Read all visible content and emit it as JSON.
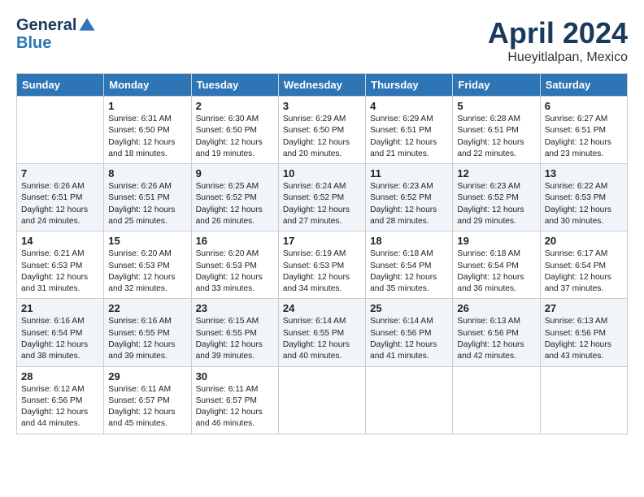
{
  "header": {
    "logo_line1": "General",
    "logo_line2": "Blue",
    "month_title": "April 2024",
    "location": "Hueyitlalpan, Mexico"
  },
  "days_of_week": [
    "Sunday",
    "Monday",
    "Tuesday",
    "Wednesday",
    "Thursday",
    "Friday",
    "Saturday"
  ],
  "weeks": [
    [
      {
        "day": "",
        "sunrise": "",
        "sunset": "",
        "daylight": ""
      },
      {
        "day": "1",
        "sunrise": "Sunrise: 6:31 AM",
        "sunset": "Sunset: 6:50 PM",
        "daylight": "Daylight: 12 hours and 18 minutes."
      },
      {
        "day": "2",
        "sunrise": "Sunrise: 6:30 AM",
        "sunset": "Sunset: 6:50 PM",
        "daylight": "Daylight: 12 hours and 19 minutes."
      },
      {
        "day": "3",
        "sunrise": "Sunrise: 6:29 AM",
        "sunset": "Sunset: 6:50 PM",
        "daylight": "Daylight: 12 hours and 20 minutes."
      },
      {
        "day": "4",
        "sunrise": "Sunrise: 6:29 AM",
        "sunset": "Sunset: 6:51 PM",
        "daylight": "Daylight: 12 hours and 21 minutes."
      },
      {
        "day": "5",
        "sunrise": "Sunrise: 6:28 AM",
        "sunset": "Sunset: 6:51 PM",
        "daylight": "Daylight: 12 hours and 22 minutes."
      },
      {
        "day": "6",
        "sunrise": "Sunrise: 6:27 AM",
        "sunset": "Sunset: 6:51 PM",
        "daylight": "Daylight: 12 hours and 23 minutes."
      }
    ],
    [
      {
        "day": "7",
        "sunrise": "Sunrise: 6:26 AM",
        "sunset": "Sunset: 6:51 PM",
        "daylight": "Daylight: 12 hours and 24 minutes."
      },
      {
        "day": "8",
        "sunrise": "Sunrise: 6:26 AM",
        "sunset": "Sunset: 6:51 PM",
        "daylight": "Daylight: 12 hours and 25 minutes."
      },
      {
        "day": "9",
        "sunrise": "Sunrise: 6:25 AM",
        "sunset": "Sunset: 6:52 PM",
        "daylight": "Daylight: 12 hours and 26 minutes."
      },
      {
        "day": "10",
        "sunrise": "Sunrise: 6:24 AM",
        "sunset": "Sunset: 6:52 PM",
        "daylight": "Daylight: 12 hours and 27 minutes."
      },
      {
        "day": "11",
        "sunrise": "Sunrise: 6:23 AM",
        "sunset": "Sunset: 6:52 PM",
        "daylight": "Daylight: 12 hours and 28 minutes."
      },
      {
        "day": "12",
        "sunrise": "Sunrise: 6:23 AM",
        "sunset": "Sunset: 6:52 PM",
        "daylight": "Daylight: 12 hours and 29 minutes."
      },
      {
        "day": "13",
        "sunrise": "Sunrise: 6:22 AM",
        "sunset": "Sunset: 6:53 PM",
        "daylight": "Daylight: 12 hours and 30 minutes."
      }
    ],
    [
      {
        "day": "14",
        "sunrise": "Sunrise: 6:21 AM",
        "sunset": "Sunset: 6:53 PM",
        "daylight": "Daylight: 12 hours and 31 minutes."
      },
      {
        "day": "15",
        "sunrise": "Sunrise: 6:20 AM",
        "sunset": "Sunset: 6:53 PM",
        "daylight": "Daylight: 12 hours and 32 minutes."
      },
      {
        "day": "16",
        "sunrise": "Sunrise: 6:20 AM",
        "sunset": "Sunset: 6:53 PM",
        "daylight": "Daylight: 12 hours and 33 minutes."
      },
      {
        "day": "17",
        "sunrise": "Sunrise: 6:19 AM",
        "sunset": "Sunset: 6:53 PM",
        "daylight": "Daylight: 12 hours and 34 minutes."
      },
      {
        "day": "18",
        "sunrise": "Sunrise: 6:18 AM",
        "sunset": "Sunset: 6:54 PM",
        "daylight": "Daylight: 12 hours and 35 minutes."
      },
      {
        "day": "19",
        "sunrise": "Sunrise: 6:18 AM",
        "sunset": "Sunset: 6:54 PM",
        "daylight": "Daylight: 12 hours and 36 minutes."
      },
      {
        "day": "20",
        "sunrise": "Sunrise: 6:17 AM",
        "sunset": "Sunset: 6:54 PM",
        "daylight": "Daylight: 12 hours and 37 minutes."
      }
    ],
    [
      {
        "day": "21",
        "sunrise": "Sunrise: 6:16 AM",
        "sunset": "Sunset: 6:54 PM",
        "daylight": "Daylight: 12 hours and 38 minutes."
      },
      {
        "day": "22",
        "sunrise": "Sunrise: 6:16 AM",
        "sunset": "Sunset: 6:55 PM",
        "daylight": "Daylight: 12 hours and 39 minutes."
      },
      {
        "day": "23",
        "sunrise": "Sunrise: 6:15 AM",
        "sunset": "Sunset: 6:55 PM",
        "daylight": "Daylight: 12 hours and 39 minutes."
      },
      {
        "day": "24",
        "sunrise": "Sunrise: 6:14 AM",
        "sunset": "Sunset: 6:55 PM",
        "daylight": "Daylight: 12 hours and 40 minutes."
      },
      {
        "day": "25",
        "sunrise": "Sunrise: 6:14 AM",
        "sunset": "Sunset: 6:56 PM",
        "daylight": "Daylight: 12 hours and 41 minutes."
      },
      {
        "day": "26",
        "sunrise": "Sunrise: 6:13 AM",
        "sunset": "Sunset: 6:56 PM",
        "daylight": "Daylight: 12 hours and 42 minutes."
      },
      {
        "day": "27",
        "sunrise": "Sunrise: 6:13 AM",
        "sunset": "Sunset: 6:56 PM",
        "daylight": "Daylight: 12 hours and 43 minutes."
      }
    ],
    [
      {
        "day": "28",
        "sunrise": "Sunrise: 6:12 AM",
        "sunset": "Sunset: 6:56 PM",
        "daylight": "Daylight: 12 hours and 44 minutes."
      },
      {
        "day": "29",
        "sunrise": "Sunrise: 6:11 AM",
        "sunset": "Sunset: 6:57 PM",
        "daylight": "Daylight: 12 hours and 45 minutes."
      },
      {
        "day": "30",
        "sunrise": "Sunrise: 6:11 AM",
        "sunset": "Sunset: 6:57 PM",
        "daylight": "Daylight: 12 hours and 46 minutes."
      },
      {
        "day": "",
        "sunrise": "",
        "sunset": "",
        "daylight": ""
      },
      {
        "day": "",
        "sunrise": "",
        "sunset": "",
        "daylight": ""
      },
      {
        "day": "",
        "sunrise": "",
        "sunset": "",
        "daylight": ""
      },
      {
        "day": "",
        "sunrise": "",
        "sunset": "",
        "daylight": ""
      }
    ]
  ]
}
